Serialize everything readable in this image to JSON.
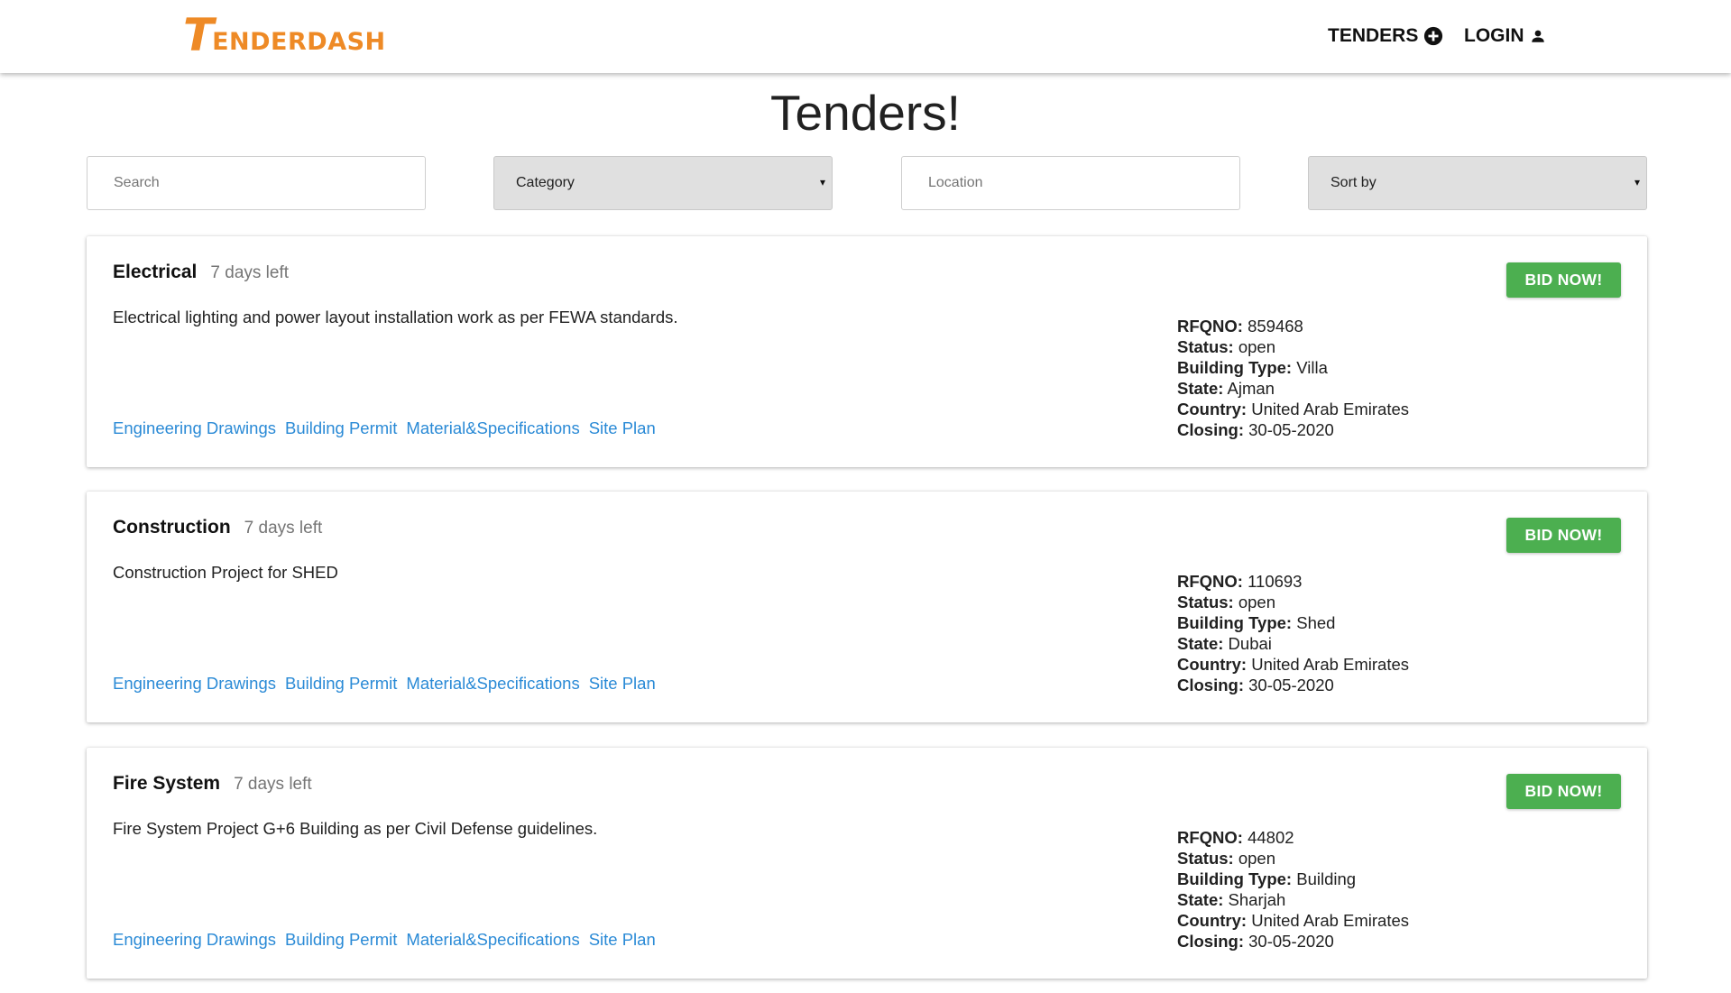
{
  "nav": {
    "logo_initial": "T",
    "logo_rest": "ENDERDASH",
    "tenders_label": "TENDERS",
    "login_label": "LOGIN"
  },
  "page": {
    "title": "Tenders!"
  },
  "filters": {
    "search_placeholder": "Search",
    "category_label": "Category",
    "location_placeholder": "Location",
    "sort_label": "Sort by",
    "caret": "▾"
  },
  "labels": {
    "rfqno": "RFQNO:",
    "status": "Status:",
    "building_type": "Building Type:",
    "state": "State:",
    "country": "Country:",
    "closing": "Closing:",
    "bid_button": "BID NOW!"
  },
  "tenders": [
    {
      "title": "Electrical",
      "days_left": "7 days left",
      "description": "Electrical lighting and power layout installation work as per FEWA standards.",
      "links": [
        "Engineering Drawings",
        "Building Permit",
        "Material&Specifications",
        "Site Plan"
      ],
      "rfqno": "859468",
      "status": "open",
      "building_type": "Villa",
      "state": "Ajman",
      "country": "United Arab Emirates",
      "closing": "30-05-2020"
    },
    {
      "title": "Construction",
      "days_left": "7 days left",
      "description": "Construction Project for SHED",
      "links": [
        "Engineering Drawings",
        "Building Permit",
        "Material&Specifications",
        "Site Plan"
      ],
      "rfqno": "110693",
      "status": "open",
      "building_type": "Shed",
      "state": "Dubai",
      "country": "United Arab Emirates",
      "closing": "30-05-2020"
    },
    {
      "title": "Fire System",
      "days_left": "7 days left",
      "description": "Fire System Project G+6 Building as per Civil Defense guidelines.",
      "links": [
        "Engineering Drawings",
        "Building Permit",
        "Material&Specifications",
        "Site Plan"
      ],
      "rfqno": "44802",
      "status": "open",
      "building_type": "Building",
      "state": "Sharjah",
      "country": "United Arab Emirates",
      "closing": "30-05-2020"
    }
  ],
  "colors": {
    "brand": "#ee8a26",
    "bid_button": "#4caf50",
    "link": "#2a8ad6",
    "select_bg": "#e0e0e0"
  },
  "icons": {
    "tenders": "plus-circle-icon",
    "login": "person-icon"
  }
}
